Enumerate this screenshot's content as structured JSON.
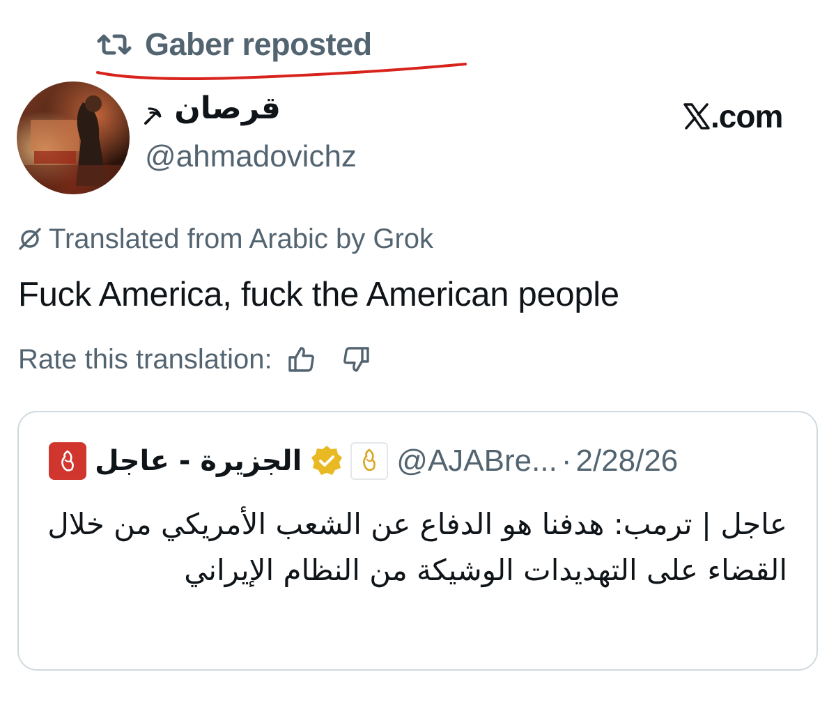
{
  "repost": {
    "label": "Gaber reposted",
    "icon": "repost-icon"
  },
  "author": {
    "display_name": "قرصان",
    "handle": "@ahmadovichz",
    "badge_icon": "sickle-icon"
  },
  "source_label": ".com",
  "translation": {
    "label": "Translated from Arabic by Grok",
    "text": "Fuck America, fuck the American people",
    "rate_label": "Rate this translation:"
  },
  "quote": {
    "name": "الجزيرة - عاجل",
    "handle": "@AJABre...",
    "separator": "·",
    "date": "2/28/26",
    "text": "عاجل | ترمب: هدفنا هو الدفاع عن الشعب الأمريكي من خلال القضاء على التهديدات الوشيكة من النظام الإيراني"
  },
  "colors": {
    "underline": "#d8231c",
    "verified": "#e8b923",
    "aj_red": "#d0352e",
    "muted": "#536471"
  }
}
